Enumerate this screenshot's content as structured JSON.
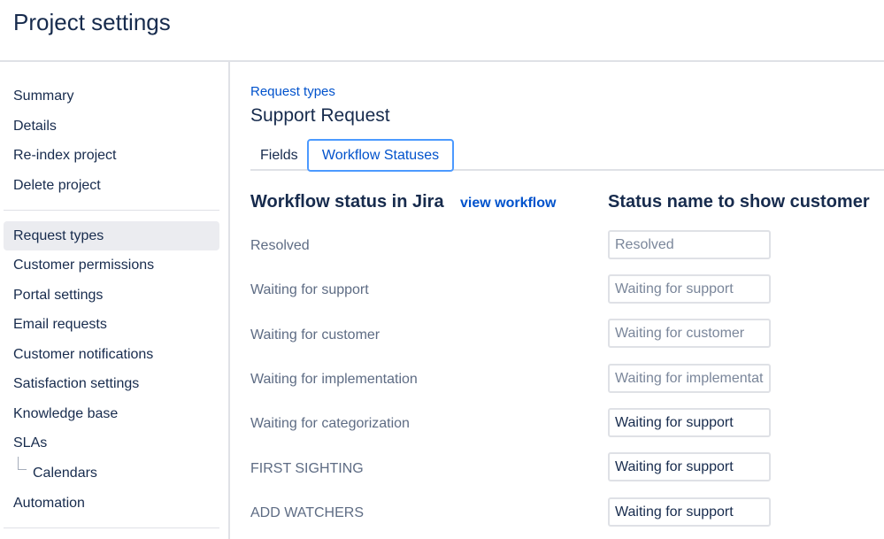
{
  "header": {
    "title": "Project settings"
  },
  "sidebar": {
    "group1": [
      "Summary",
      "Details",
      "Re-index project",
      "Delete project"
    ],
    "group2": [
      {
        "label": "Request types",
        "active": true
      },
      {
        "label": "Customer permissions"
      },
      {
        "label": "Portal settings"
      },
      {
        "label": "Email requests"
      },
      {
        "label": "Customer notifications"
      },
      {
        "label": "Satisfaction settings"
      },
      {
        "label": "Knowledge base"
      },
      {
        "label": "SLAs"
      },
      {
        "label": "Calendars",
        "sub": true
      },
      {
        "label": "Automation"
      }
    ]
  },
  "main": {
    "breadcrumb": "Request types",
    "title": "Support Request",
    "tabs": [
      {
        "label": "Fields"
      },
      {
        "label": "Workflow Statuses",
        "active": true
      }
    ],
    "columns": {
      "left": "Workflow status in Jira",
      "view_workflow": "view workflow",
      "right": "Status name to show customer"
    },
    "rows": [
      {
        "status": "Resolved",
        "value": "",
        "placeholder": "Resolved"
      },
      {
        "status": "Waiting for support",
        "value": "",
        "placeholder": "Waiting for support"
      },
      {
        "status": "Waiting for customer",
        "value": "",
        "placeholder": "Waiting for customer"
      },
      {
        "status": "Waiting for implementation",
        "value": "",
        "placeholder": "Waiting for implementat"
      },
      {
        "status": "Waiting for categorization",
        "value": "Waiting for support",
        "placeholder": ""
      },
      {
        "status": "FIRST SIGHTING",
        "value": "Waiting for support",
        "placeholder": ""
      },
      {
        "status": "ADD WATCHERS",
        "value": "Waiting for support",
        "placeholder": ""
      }
    ]
  },
  "colors": {
    "link": "#0052CC",
    "text": "#172B4D",
    "muted": "#5E6C84",
    "active_bg": "#EBECF0",
    "focus_border": "#4C9AFF"
  }
}
